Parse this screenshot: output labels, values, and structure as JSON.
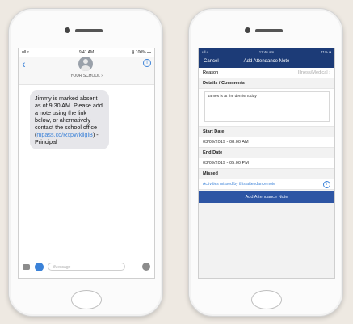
{
  "left_phone": {
    "status": {
      "signal": "ull ≈",
      "time": "9:41 AM",
      "battery": "∦ 100% ▬"
    },
    "header": {
      "sender": "YOUR SCHOOL ›"
    },
    "message": {
      "part1": "Jimmy is marked absent as of 9:30 AM. Please add a note using the link below, or alternatively contact the school office (",
      "link": "mpass.co/RxpWkllglB",
      "part2": ") - Principal"
    },
    "input": {
      "placeholder": "iMessage"
    }
  },
  "right_phone": {
    "status": {
      "signal": "ull ≈",
      "time": "11:46 am",
      "battery": "71% ■"
    },
    "nav": {
      "cancel": "Cancel",
      "title": "Add Attendance Note"
    },
    "reason": {
      "label": "Reason",
      "value": "Illness/Medical ›"
    },
    "details_label": "Details / Comments",
    "details_text": "James is at the dentist today",
    "start_label": "Start Date",
    "start_value": "03/09/2019 - 08:00 AM",
    "end_label": "End Date",
    "end_value": "03/09/2019 - 05:00 PM",
    "missed_label": "Missed",
    "missed_link": "Activities missed by this attendance note",
    "button": "Add Attendance Note"
  },
  "colors": {
    "accent": "#3b82d8",
    "nav_bg": "#1c3b77",
    "button_bg": "#2d55a4"
  }
}
